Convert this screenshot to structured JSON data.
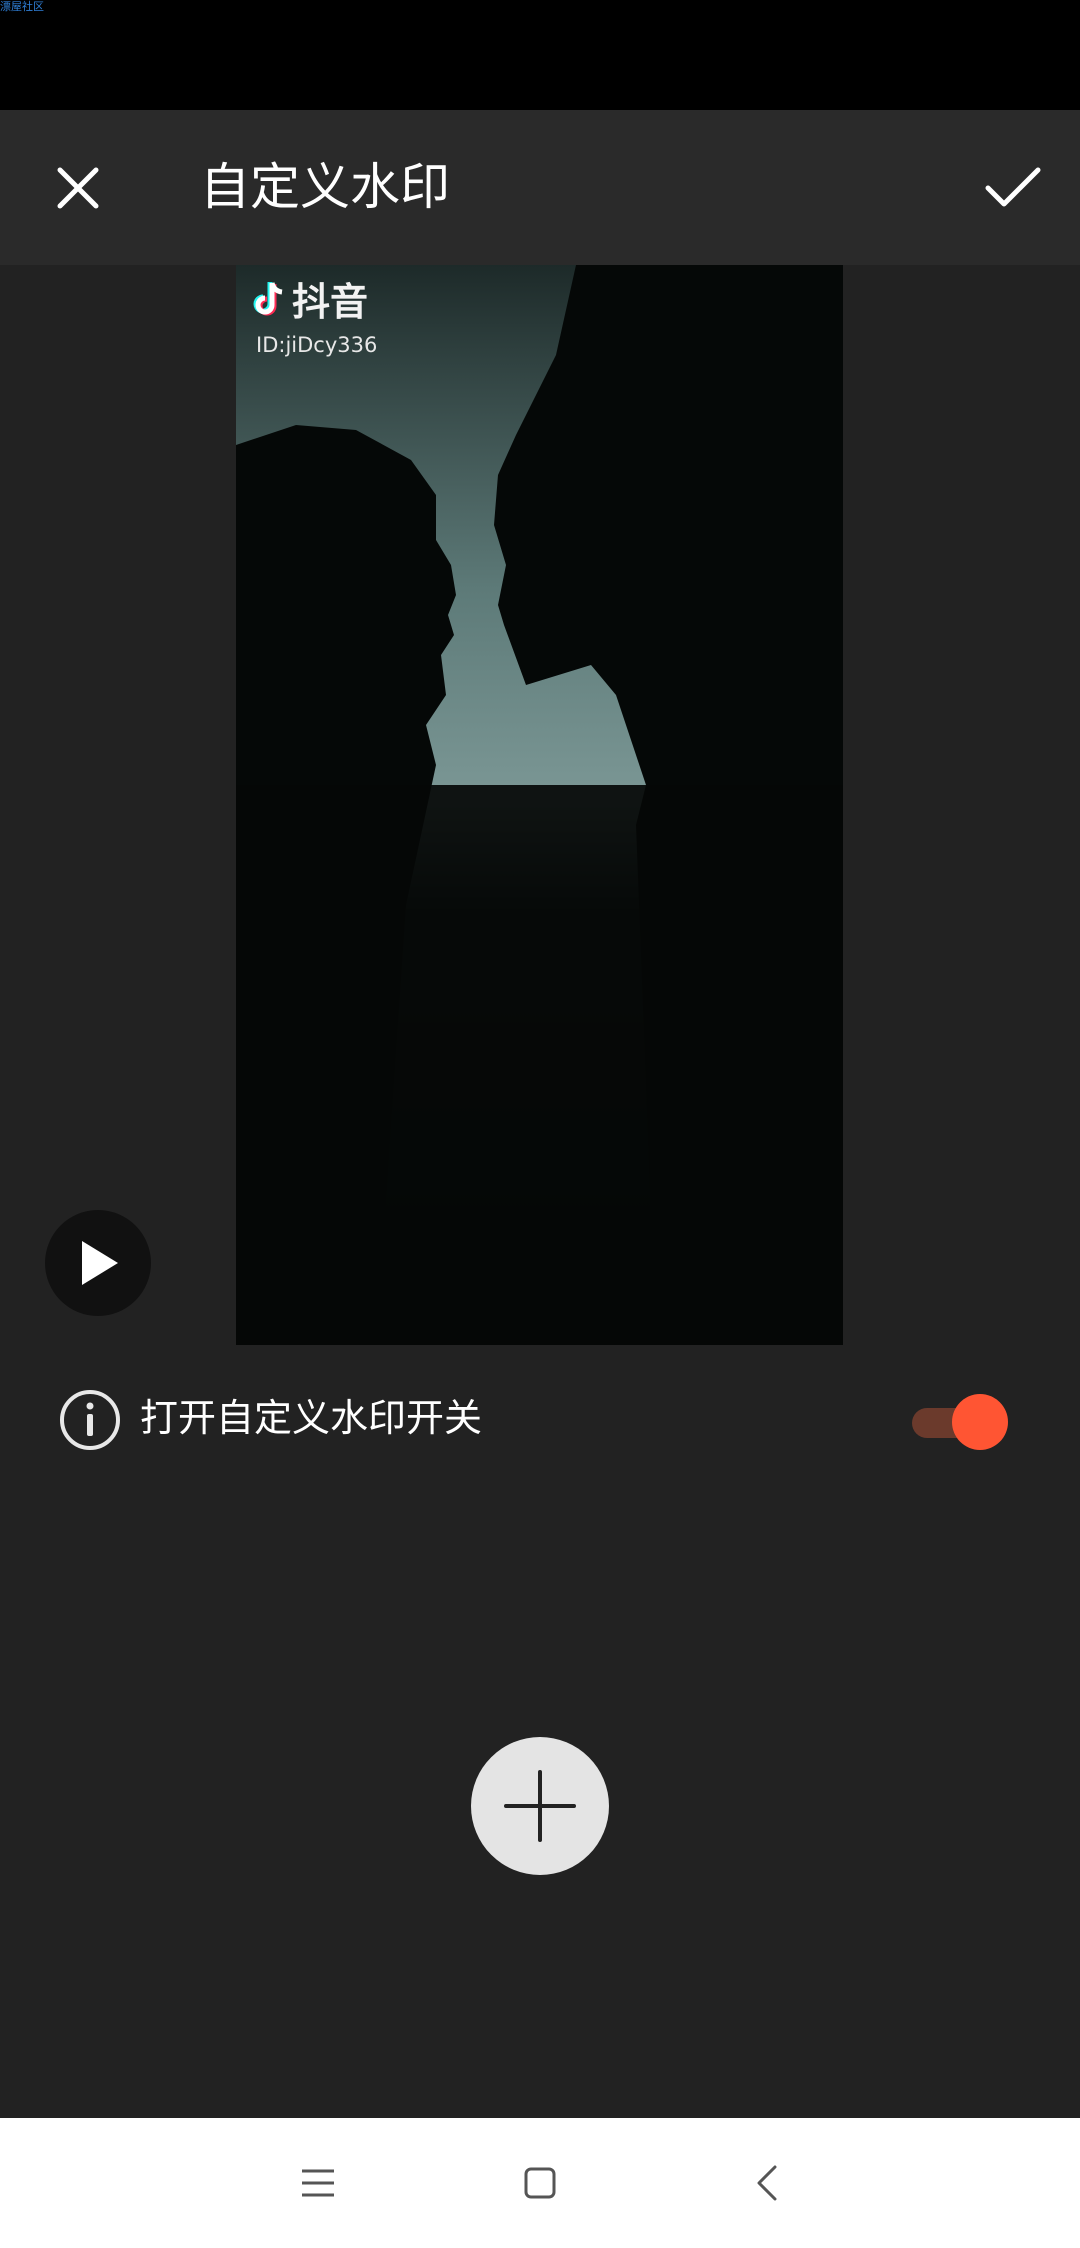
{
  "status_bar": {
    "watermark_text": "漂屋社区"
  },
  "header": {
    "title": "自定义水印",
    "close_icon": "close-icon",
    "confirm_icon": "check-icon"
  },
  "preview": {
    "watermark_brand": "抖音",
    "watermark_id": "ID:jiDcy336",
    "play_icon": "play-icon"
  },
  "toggle": {
    "label": "打开自定义水印开关",
    "enabled": true,
    "accent_color": "#ff5533",
    "info_icon": "info-icon"
  },
  "actions": {
    "add_icon": "plus-icon"
  },
  "nav_bar": {
    "items": [
      "menu-icon",
      "home-icon",
      "back-icon"
    ]
  }
}
